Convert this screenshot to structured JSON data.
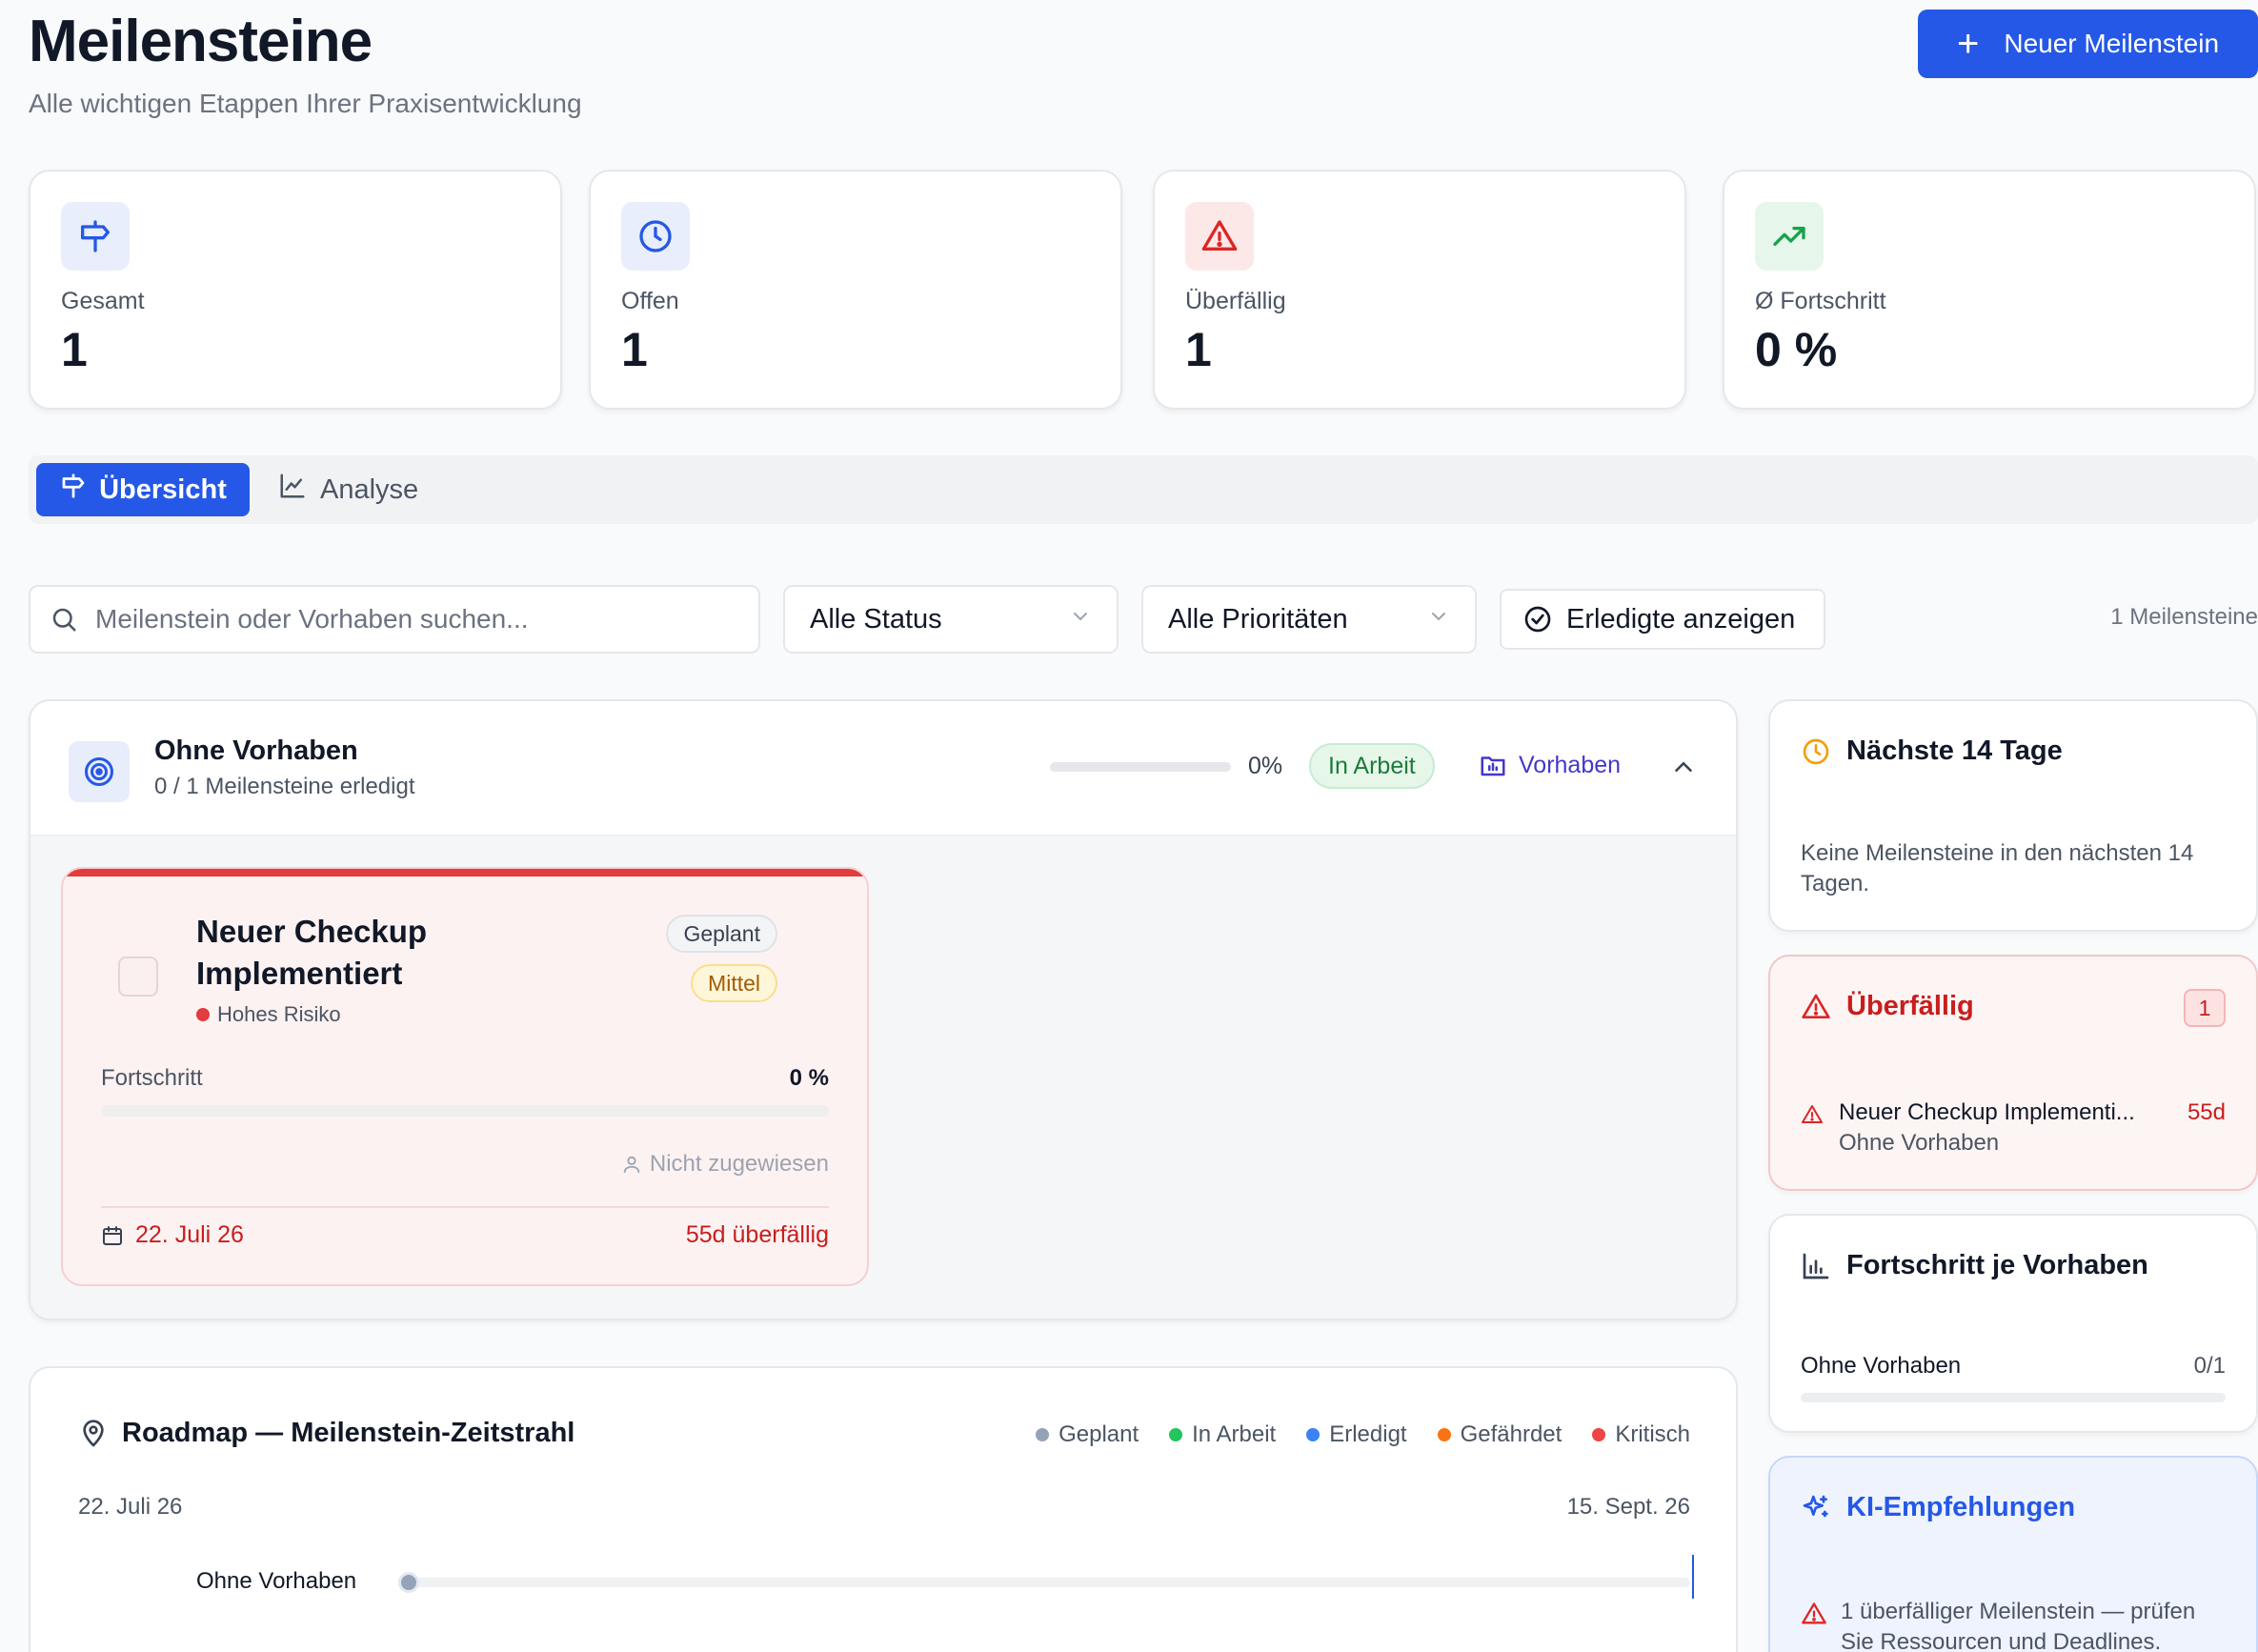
{
  "header": {
    "title": "Meilensteine",
    "subtitle": "Alle wichtigen Etappen Ihrer Praxisentwicklung",
    "new_button": "Neuer Meilenstein"
  },
  "stats": [
    {
      "label": "Gesamt",
      "value": "1",
      "icon": "signpost-icon",
      "color": "#2558e6"
    },
    {
      "label": "Offen",
      "value": "1",
      "icon": "clock-icon",
      "color": "#2558e6"
    },
    {
      "label": "Überfällig",
      "value": "1",
      "icon": "alert-triangle-icon",
      "color": "#dc2626"
    },
    {
      "label": "Ø Fortschritt",
      "value": "0 %",
      "icon": "trending-up-icon",
      "color": "#16a34a"
    }
  ],
  "tabs": [
    {
      "label": "Übersicht",
      "active": true
    },
    {
      "label": "Analyse",
      "active": false
    }
  ],
  "filters": {
    "search_placeholder": "Meilenstein oder Vorhaben suchen...",
    "status": "Alle Status",
    "priority": "Alle Prioritäten",
    "show_done": "Erledigte anzeigen",
    "count": "1 Meilensteine"
  },
  "group": {
    "title": "Ohne Vorhaben",
    "subtitle": "0 / 1 Meilensteine erledigt",
    "percent": "0%",
    "progress": 0,
    "status": "In Arbeit",
    "link": "Vorhaben"
  },
  "milestone": {
    "title": "Neuer Checkup Implementiert",
    "status": "Geplant",
    "priority": "Mittel",
    "risk": "Hohes Risiko",
    "progress_label": "Fortschritt",
    "progress_value": "0 %",
    "progress": 0,
    "assignee": "Nicht zugewiesen",
    "date": "22. Juli 26",
    "overdue": "55d überfällig"
  },
  "roadmap": {
    "title": "Roadmap — Meilenstein-Zeitstrahl",
    "legend": [
      {
        "label": "Geplant",
        "color": "#94a3b8"
      },
      {
        "label": "In Arbeit",
        "color": "#22c55e"
      },
      {
        "label": "Erledigt",
        "color": "#3b82f6"
      },
      {
        "label": "Gefährdet",
        "color": "#f97316"
      },
      {
        "label": "Kritisch",
        "color": "#ef4444"
      }
    ],
    "start_date": "22. Juli 26",
    "end_date": "15. Sept. 26",
    "rows": [
      {
        "label": "Ohne Vorhaben"
      }
    ]
  },
  "sidebar": {
    "next14": {
      "title": "Nächste 14 Tage",
      "empty": "Keine Meilensteine in den nächsten 14 Tagen."
    },
    "overdue": {
      "title": "Überfällig",
      "count": "1",
      "item_title": "Neuer Checkup Implementi...",
      "item_sub": "Ohne Vorhaben",
      "item_days": "55d"
    },
    "progress": {
      "title": "Fortschritt je Vorhaben",
      "row_label": "Ohne Vorhaben",
      "row_value": "0/1",
      "progress": 0
    },
    "ki": {
      "title": "KI-Empfehlungen",
      "text": "1 überfälliger Meilenstein — prüfen Sie Ressourcen und Deadlines."
    }
  }
}
